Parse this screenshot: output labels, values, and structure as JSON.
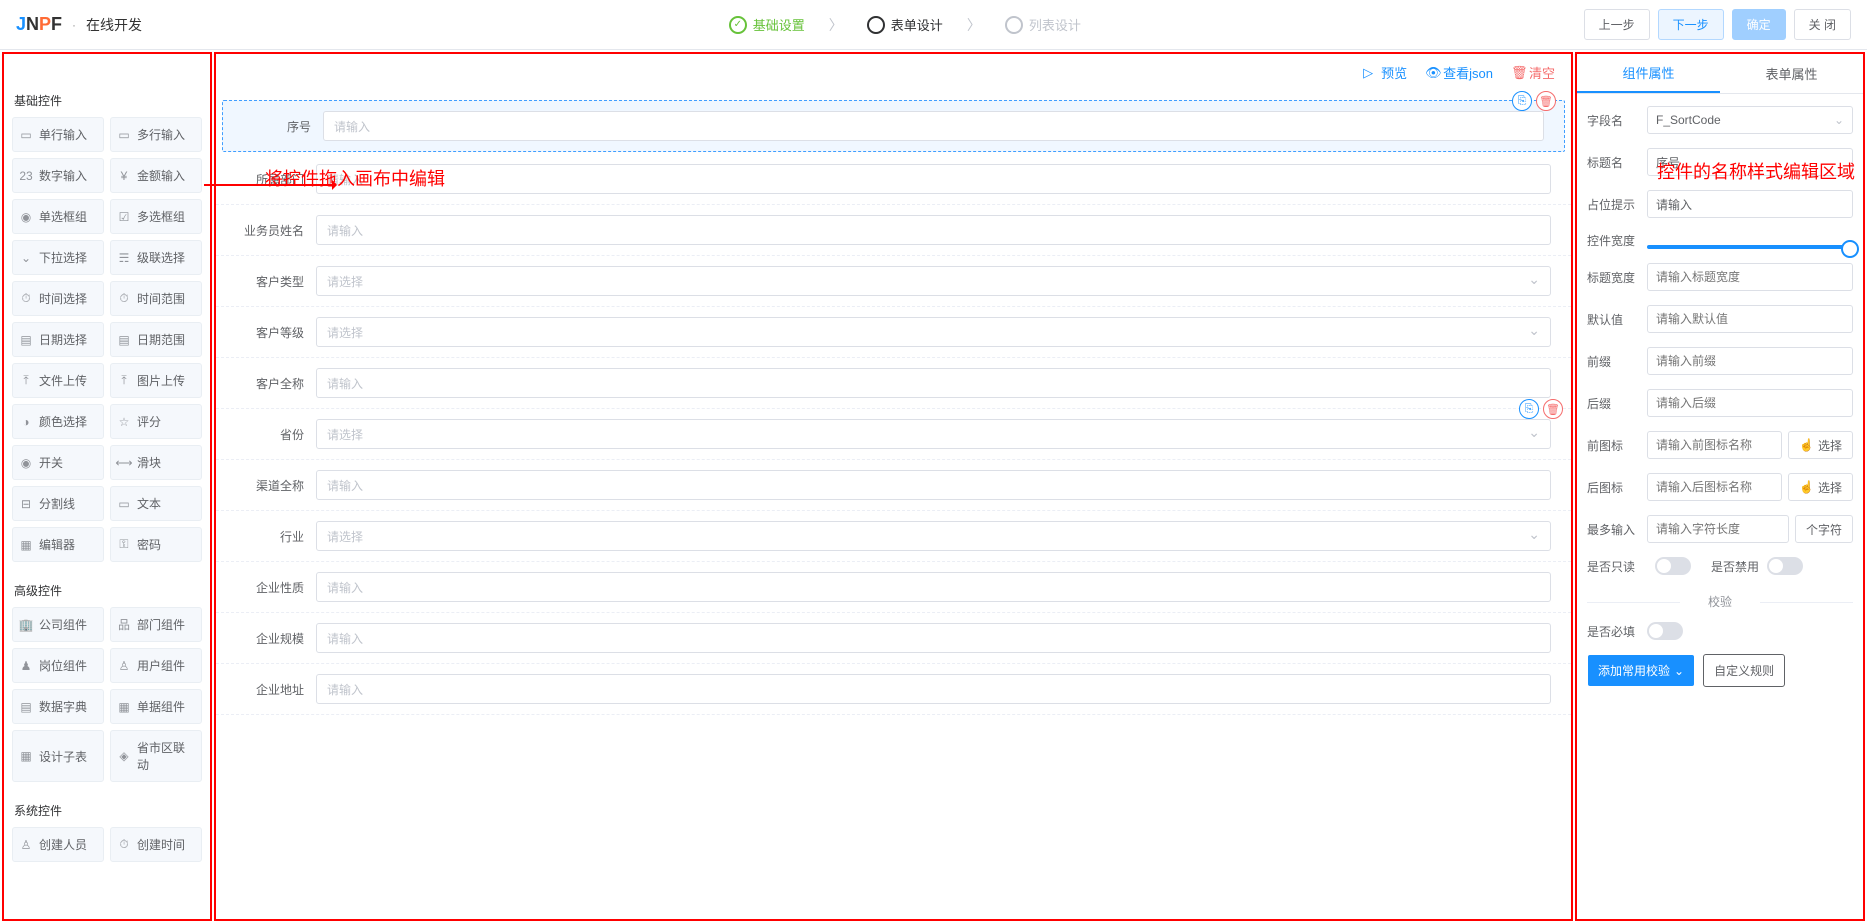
{
  "header": {
    "logo": "JNPF",
    "pageTitle": "在线开发",
    "steps": [
      {
        "label": "基础设置",
        "state": "done"
      },
      {
        "label": "表单设计",
        "state": "active"
      },
      {
        "label": "列表设计",
        "state": "disabled"
      }
    ],
    "btns": {
      "prev": "上一步",
      "next": "下一步",
      "confirm": "确定",
      "close": "关 闭"
    }
  },
  "leftPanel": {
    "sections": [
      {
        "title": "基础控件",
        "items": [
          {
            "icon": "▭",
            "label": "单行输入"
          },
          {
            "icon": "▭",
            "label": "多行输入"
          },
          {
            "icon": "23",
            "label": "数字输入"
          },
          {
            "icon": "¥",
            "label": "金额输入"
          },
          {
            "icon": "◉",
            "label": "单选框组"
          },
          {
            "icon": "☑",
            "label": "多选框组"
          },
          {
            "icon": "⌄",
            "label": "下拉选择"
          },
          {
            "icon": "☴",
            "label": "级联选择"
          },
          {
            "icon": "⏱",
            "label": "时间选择"
          },
          {
            "icon": "⏱",
            "label": "时间范围"
          },
          {
            "icon": "▤",
            "label": "日期选择"
          },
          {
            "icon": "▤",
            "label": "日期范围"
          },
          {
            "icon": "⤒",
            "label": "文件上传"
          },
          {
            "icon": "⤒",
            "label": "图片上传"
          },
          {
            "icon": "◑",
            "label": "颜色选择"
          },
          {
            "icon": "☆",
            "label": "评分"
          },
          {
            "icon": "◉",
            "label": "开关"
          },
          {
            "icon": "⟷",
            "label": "滑块"
          },
          {
            "icon": "⊟",
            "label": "分割线"
          },
          {
            "icon": "▭",
            "label": "文本"
          },
          {
            "icon": "▦",
            "label": "编辑器"
          },
          {
            "icon": "⚿",
            "label": "密码"
          }
        ]
      },
      {
        "title": "高级控件",
        "items": [
          {
            "icon": "🏢",
            "label": "公司组件"
          },
          {
            "icon": "品",
            "label": "部门组件"
          },
          {
            "icon": "♟",
            "label": "岗位组件"
          },
          {
            "icon": "♙",
            "label": "用户组件"
          },
          {
            "icon": "▤",
            "label": "数据字典"
          },
          {
            "icon": "▦",
            "label": "单据组件"
          },
          {
            "icon": "▦",
            "label": "设计子表"
          },
          {
            "icon": "◈",
            "label": "省市区联动"
          }
        ]
      },
      {
        "title": "系统控件",
        "items": [
          {
            "icon": "♙",
            "label": "创建人员"
          },
          {
            "icon": "⏱",
            "label": "创建时间"
          }
        ]
      }
    ]
  },
  "centerToolbar": {
    "preview": "预览",
    "viewJson": "查看json",
    "clear": "清空"
  },
  "formRows": [
    {
      "label": "序号",
      "placeholder": "请输入",
      "type": "input",
      "selected": true
    },
    {
      "label": "所属部门",
      "placeholder": "请输入",
      "type": "input"
    },
    {
      "label": "业务员姓名",
      "placeholder": "请输入",
      "type": "input"
    },
    {
      "label": "客户类型",
      "placeholder": "请选择",
      "type": "select"
    },
    {
      "label": "客户等级",
      "placeholder": "请选择",
      "type": "select"
    },
    {
      "label": "客户全称",
      "placeholder": "请输入",
      "type": "input"
    },
    {
      "label": "省份",
      "placeholder": "请选择",
      "type": "select",
      "actions": true
    },
    {
      "label": "渠道全称",
      "placeholder": "请输入",
      "type": "input"
    },
    {
      "label": "行业",
      "placeholder": "请选择",
      "type": "select"
    },
    {
      "label": "企业性质",
      "placeholder": "请输入",
      "type": "input"
    },
    {
      "label": "企业规模",
      "placeholder": "请输入",
      "type": "input"
    },
    {
      "label": "企业地址",
      "placeholder": "请输入",
      "type": "input"
    }
  ],
  "annotations": {
    "dragHint": "将控件拖入画布中编辑",
    "rightHint": "控件的名称样式编辑区域"
  },
  "rightPanel": {
    "tabs": {
      "comp": "组件属性",
      "form": "表单属性"
    },
    "fields": {
      "fieldName": {
        "label": "字段名",
        "value": "F_SortCode"
      },
      "titleName": {
        "label": "标题名",
        "value": "序号"
      },
      "placeholder": {
        "label": "占位提示",
        "value": "请输入"
      },
      "width": {
        "label": "控件宽度"
      },
      "titleWidth": {
        "label": "标题宽度",
        "placeholder": "请输入标题宽度"
      },
      "defaultVal": {
        "label": "默认值",
        "placeholder": "请输入默认值"
      },
      "prefix": {
        "label": "前缀",
        "placeholder": "请输入前缀"
      },
      "suffix": {
        "label": "后缀",
        "placeholder": "请输入后缀"
      },
      "preIcon": {
        "label": "前图标",
        "placeholder": "请输入前图标名称",
        "btn": "选择"
      },
      "sufIcon": {
        "label": "后图标",
        "placeholder": "请输入后图标名称",
        "btn": "选择"
      },
      "maxInput": {
        "label": "最多输入",
        "placeholder": "请输入字符长度",
        "unit": "个字符"
      },
      "readonly": {
        "label": "是否只读"
      },
      "disabled": {
        "label": "是否禁用"
      },
      "validateTitle": "校验",
      "required": {
        "label": "是否必填"
      },
      "addRule": "添加常用校验",
      "customRule": "自定义规则"
    }
  }
}
